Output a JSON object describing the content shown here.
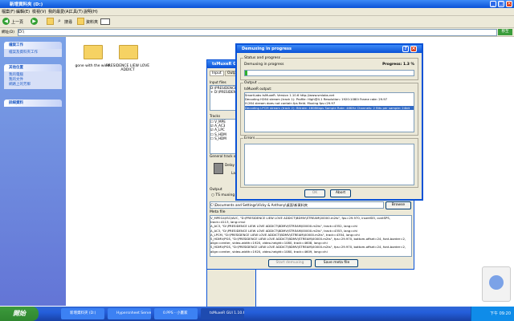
{
  "explorer": {
    "title": "新增資料夾 (D:)",
    "menu": [
      "檔案(F)",
      "編輯(E)",
      "檢視(V)",
      "我的最愛(A)",
      "工具(T)",
      "說明(H)"
    ],
    "toolbar": {
      "back_label": "上一頁",
      "search_label": "搜尋",
      "folders_label": "資料夾"
    },
    "address_label": "網址(D)",
    "address_value": "D:\\",
    "go_label": "移至"
  },
  "sidebar": {
    "panels": [
      {
        "title": "檔案工作",
        "links": [
          "檔案及資料夾工作"
        ]
      },
      {
        "title": "其他位置",
        "links": [
          "我的電腦",
          "我的文件",
          "網路上的芳鄰"
        ]
      },
      {
        "title": "詳細資料",
        "links": []
      }
    ]
  },
  "folders": [
    {
      "name": "gone with the wind"
    },
    {
      "name": "PRESIDENCE LIEW LOVE ADDICT"
    }
  ],
  "back_dialog": {
    "title": "tsMuxeR GUI",
    "tabs": [
      "Input",
      "Output"
    ],
    "input_files_label": "Input files",
    "input_files": [
      "D:\\PRESIDENCE LIEW",
      "+ D:\\PRESIDENCE"
    ],
    "tracks_label": "Tracks",
    "track_codes": [
      "V_MPE",
      "A_AC3",
      "A_LPC",
      "S_HDM",
      "S_HDM"
    ],
    "general_label": "General track o",
    "delay_label": "Delay",
    "lang_label": "La"
  },
  "main_dialog": {
    "output_label": "Output",
    "ts_muxing": "TS muxing",
    "output_path": "C:\\Documents and Settings\\Vicky & Anthony\\桌面\\新資料夾",
    "browse_label": "Browse",
    "meta_label": "Meta file",
    "meta_lines": [
      "V_MPEG4/ISO/AVC, \"D:\\PRESIDENCE LIEW LOVE ADDICT\\BDMV\\STREAM\\00000.m2ts\", fps=29.970, insertSEI, contSPS,",
      "track=4113, lang=mul",
      "A_AC3, \"D:\\PRESIDENCE LIEW LOVE ADDICT\\BDMV\\STREAM\\00000.m2ts\", track=4352, lang=chi",
      "A_AC3, \"D:\\PRESIDENCE LIEW LOVE ADDICT\\BDMV\\STREAM\\00000.m2ts\", track=4353, lang=chi",
      "A_LPCM, \"D:\\PRESIDENCE LIEW LOVE ADDICT\\BDMV\\STREAM\\00000.m2ts\", track=4354, lang=chi",
      "S_HDMV/PGS, \"D:\\PRESIDENCE LIEW LOVE ADDICT\\BDMV\\STREAM\\00000.m2ts\", fps=29.970, bottom-offset=24, font-border=2,",
      "align=center, video-width=1920, video-height=1080, track=4608, lang=chi",
      "S_HDMV/PGS, \"D:\\PRESIDENCE LIEW LOVE ADDICT\\BDMV\\STREAM\\00000.m2ts\", fps=29.970, bottom-offset=24, font-border=2,",
      "align=center, video-width=1920, video-height=1080, track=4609, lang=chi"
    ],
    "start_label": "Start demuxing",
    "save_meta_label": "Save meta file"
  },
  "progress_dialog": {
    "title": "Demuxing in progress",
    "status_group": "Status and progress",
    "status_text": "Demuxing in progress",
    "progress_text": "Progress: 1.3 %",
    "progress_fraction": 0.013,
    "output_group": "Output",
    "output_header": "tsMuxeR output:",
    "output_lines": [
      "SmartLabs tsMuxeR.  Version 1.10.6  http://www.smlabs.net",
      "Decoding H264 stream (track 1): Profile: High@4.1  Resolution: 1920:1080i  Frame rate: 29.97",
      "H.264 stream does not contain fps field. Muxing fps=29.97",
      "Decoding LPCM stream (track 2): Bitrate: 4608Kbps Sample Rate: 48KHz  Channels: 2  Bits per sample: 24bit"
    ],
    "highlighted_index": 3,
    "errors_group": "Errors",
    "ok_label": "OK",
    "abort_label": "Abort"
  },
  "taskbar": {
    "start_label": "開始",
    "tasks": [
      "新增資料夾 (D:)",
      "Hypersnheet Server Co...",
      "0.PPS - 小畫家",
      "tsMuxeR GUI 1.10.6"
    ],
    "active_index": 3,
    "clock": "下午 09:20"
  }
}
